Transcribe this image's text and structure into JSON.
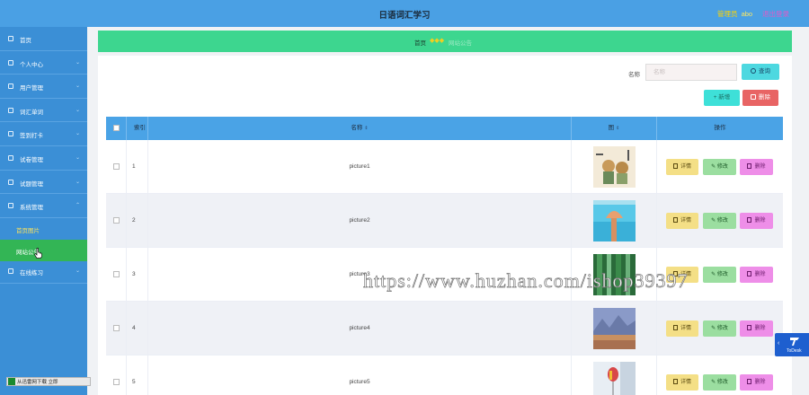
{
  "header": {
    "title": "日语词汇学习",
    "role_label": "管理员",
    "username": "abo",
    "logout_label": "退出登录"
  },
  "sidebar": {
    "items": [
      {
        "label": "首页",
        "icon": "home-icon",
        "has_children": false
      },
      {
        "label": "个人中心",
        "icon": "user-icon",
        "has_children": true
      },
      {
        "label": "用户管理",
        "icon": "users-icon",
        "has_children": true
      },
      {
        "label": "词汇单词",
        "icon": "book-icon",
        "has_children": true
      },
      {
        "label": "签到打卡",
        "icon": "calendar-icon",
        "has_children": true
      },
      {
        "label": "试卷管理",
        "icon": "document-icon",
        "has_children": true
      },
      {
        "label": "试题管理",
        "icon": "question-icon",
        "has_children": true
      },
      {
        "label": "系统管理",
        "icon": "settings-icon",
        "has_children": true
      }
    ],
    "sub_items": [
      {
        "label": "首页图片",
        "active": false
      },
      {
        "label": "网站公告",
        "active": true
      }
    ],
    "last_item": {
      "label": "在线练习",
      "icon": "edit-icon",
      "has_children": true
    }
  },
  "taskbar": {
    "label": "从迅雷网下载 立即"
  },
  "breadcrumb": {
    "home": "首页",
    "separator": "◆◆◆",
    "current": "网站公告"
  },
  "search": {
    "label": "名称",
    "placeholder": "名称",
    "button_label": "查询"
  },
  "toolbar": {
    "add_label": "新增",
    "delete_label": "删除"
  },
  "table": {
    "columns": [
      "",
      "索引",
      "名称",
      "图",
      "操作"
    ],
    "rows": [
      {
        "index": "1",
        "name": "picture1",
        "thumb_colors": [
          "#f3ead8",
          "#c89a5a"
        ]
      },
      {
        "index": "2",
        "name": "picture2",
        "thumb_colors": [
          "#58c8e8",
          "#e8a070"
        ]
      },
      {
        "index": "3",
        "name": "picture3",
        "thumb_colors": [
          "#2a6a3a",
          "#7abf8a"
        ]
      },
      {
        "index": "4",
        "name": "picture4",
        "thumb_colors": [
          "#6a7aa8",
          "#c89060"
        ]
      },
      {
        "index": "5",
        "name": "picture5",
        "thumb_colors": [
          "#e8eef4",
          "#d84848"
        ]
      }
    ],
    "row_actions": {
      "detail": "详情",
      "edit": "修改",
      "delete": "删除"
    }
  },
  "watermark": "https://www.huzhan.com/ishop39397",
  "todesk": {
    "label": "ToDesk"
  },
  "colors": {
    "header": "#4aa0e4",
    "sidebar": "#3b8fd6",
    "breadcrumb": "#3dd68f",
    "active_menu": "#33b555",
    "table_header": "#4aa3e6"
  }
}
